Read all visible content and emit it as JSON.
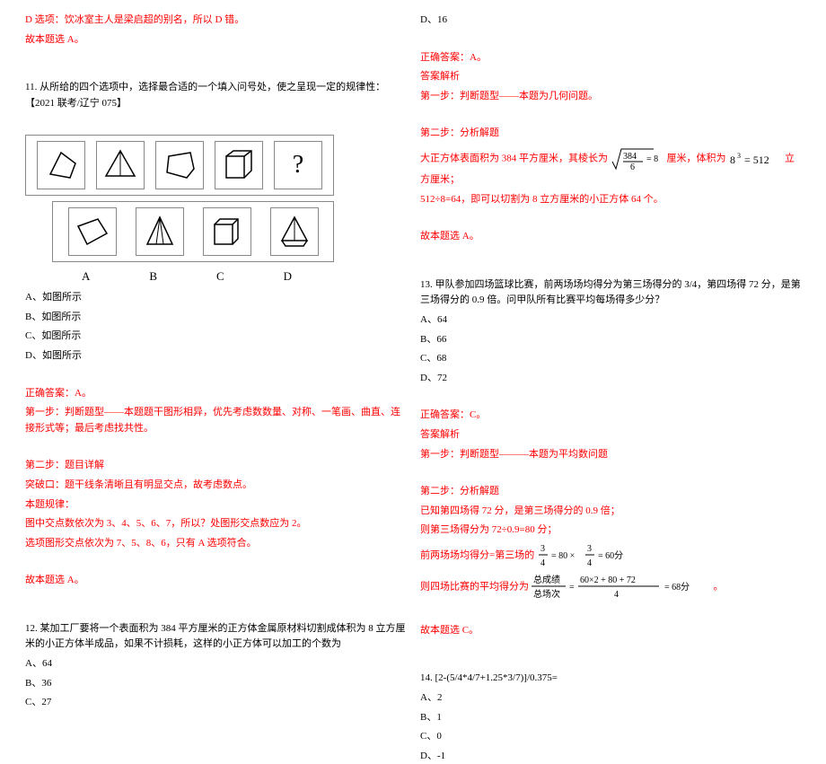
{
  "left": {
    "d_note": "D 选项：饮冰室主人是梁启超的别名，所以 D 错。",
    "conclude_a1": "故本题选 A。",
    "q11_title": "11. 从所给的四个选项中，选择最合适的一个填入问号处，使之呈现一定的规律性：【2021 联考/辽宁 075】",
    "labels": {
      "a": "A",
      "b": "B",
      "c": "C",
      "d": "D"
    },
    "opt_a": "A、如图所示",
    "opt_b": "B、如图所示",
    "opt_c": "C、如图所示",
    "opt_d": "D、如图所示",
    "ans": "正确答案：A。",
    "step1": "第一步：判断题型——本题题干图形相异，优先考虑数数量、对称、一笔画、曲直、连接形式等；最后考虑找共性。",
    "step2_hdr": "第二步：题目详解",
    "breakthrough": "突破口：题干线条清晰且有明显交点，故考虑数点。",
    "rule_hdr": "本题规律：",
    "rule1": "图中交点数依次为 3、4、5、6、7，所以？处图形交点数应为 2。",
    "rule2": "选项图形交点依次为 7、5、8、6，只有 A 选项符合。",
    "conclude_a2": "故本题选 A。",
    "q12_title": "12. 某加工厂要将一个表面积为 384 平方厘米的正方体金属原材料切割成体积为 8 立方厘米的小正方体半成品，如果不计损耗，这样的小正方体可以加工的个数为",
    "q12_a": "A、64",
    "q12_b": "B、36",
    "q12_c": "C、27"
  },
  "right": {
    "q12_d": "D、16",
    "ans12": "正确答案：A。",
    "ans_hdr": "答案解析",
    "step1_12": "第一步：判断题型——本题为几何问题。",
    "step2_12_hdr": "第二步：分析解题",
    "step2_12a_pre": "大正方体表面积为 384 平方厘米，其棱长为",
    "step2_12a_mid": "厘米，体积为",
    "step2_12a_post": "立方厘米；",
    "step2_12b": "512÷8=64，即可以切割为 8 立方厘米的小正方体 64 个。",
    "conclude_a3": "故本题选 A。",
    "q13_title": "13. 甲队参加四场篮球比赛，前两场场均得分为第三场得分的 3/4，第四场得 72 分，是第三场得分的 0.9 倍。问甲队所有比赛平均每场得多少分？",
    "q13_a": "A、64",
    "q13_b": "B、66",
    "q13_c": "C、68",
    "q13_d": "D、72",
    "ans13": "正确答案：C。",
    "step1_13": "第一步：判断题型———本题为平均数问题",
    "step2_13_hdr": "第二步：分析解题",
    "step2_13a": "已知第四场得 72 分，是第三场得分的 0.9 倍；",
    "step2_13b": "则第三场得分为 72÷0.9=80 分；",
    "step2_13c_pre": "前两场场均得分=第三场的",
    "step2_13d_pre": "则四场比赛的平均得分为",
    "conclude_c": "故本题选 C。",
    "q14_title": "14. [2-(5/4*4/7+1.25*3/7)]/0.375=",
    "q14_a": "A、2",
    "q14_b": "B、1",
    "q14_c": "C、0",
    "q14_d": "D、-1"
  }
}
